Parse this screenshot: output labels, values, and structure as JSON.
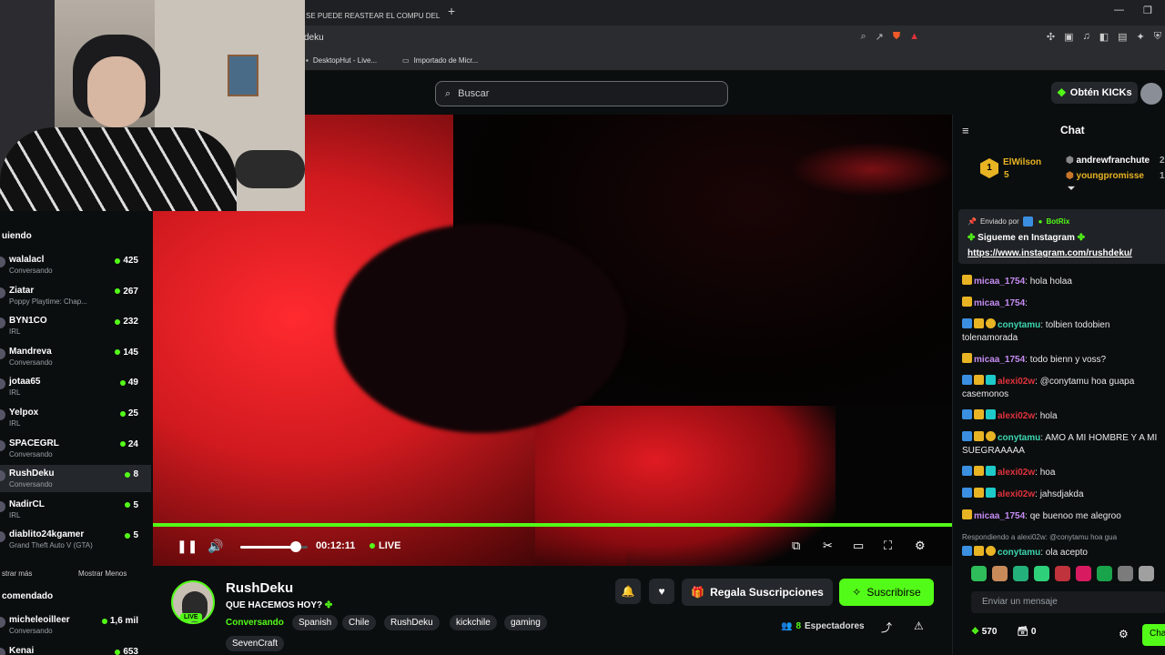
{
  "browser": {
    "tab_title": "SE PUEDE REASTEAR EL COMPU DEL",
    "new_tab": "+",
    "url": "deku",
    "bookmarks": [
      {
        "label": "DesktopHut - Live..."
      },
      {
        "label": "Importado de Micr..."
      }
    ]
  },
  "header": {
    "search_placeholder": "Buscar",
    "kicks_label": "Obtén KICKs"
  },
  "sidebar": {
    "following_title": "uiendo",
    "channels": [
      {
        "name": "walalacl",
        "category": "Conversando",
        "viewers": "425"
      },
      {
        "name": "Ziatar",
        "category": "Poppy Playtime: Chap...",
        "viewers": "267"
      },
      {
        "name": "BYN1CO",
        "category": "IRL",
        "viewers": "232"
      },
      {
        "name": "Mandreva",
        "category": "Conversando",
        "viewers": "145"
      },
      {
        "name": "jotaa65",
        "category": "IRL",
        "viewers": "49"
      },
      {
        "name": "Yelpox",
        "category": "IRL",
        "viewers": "25"
      },
      {
        "name": "SPACEGRL",
        "category": "Conversando",
        "viewers": "24"
      },
      {
        "name": "RushDeku",
        "category": "Conversando",
        "viewers": "8"
      },
      {
        "name": "NadirCL",
        "category": "IRL",
        "viewers": "5"
      },
      {
        "name": "diablito24kgamer",
        "category": "Grand Theft Auto V (GTA)",
        "viewers": "5"
      }
    ],
    "show_more": "strar más",
    "show_less": "Mostrar Menos",
    "recommended_title": "comendado",
    "recommended": [
      {
        "name": "micheleoilleer",
        "category": "Conversando",
        "viewers": "1,6 mil"
      },
      {
        "name": "Kenai",
        "category": "",
        "viewers": "653"
      }
    ]
  },
  "player": {
    "time": "00:12:11",
    "live_label": "LIVE",
    "volume": 0.82,
    "progress": 1.0
  },
  "stream": {
    "channel": "RushDeku",
    "live_badge": "LIVE",
    "title": "QUE HACEMOS HOY?",
    "category": "Conversando",
    "tags": [
      "Spanish",
      "Chile",
      "RushDeku",
      "kickchile",
      "gaming",
      "SevenCraft"
    ],
    "gift_label": "Regala Suscripciones",
    "subscribe_label": "Suscribirse",
    "viewers_count": "8",
    "viewers_label": "Espectadores"
  },
  "chat": {
    "title": "Chat",
    "leaderboard": [
      {
        "rank": "1",
        "name": "ElWilson",
        "count": "5"
      },
      {
        "name": "andrewfranchute",
        "count": "2"
      },
      {
        "name": "youngpromisse",
        "count": "1"
      }
    ],
    "pinned": {
      "sent_by": "Enviado por",
      "sender": "BotRix",
      "text": "Sigueme en Instagram",
      "link": "https://www.instagram.com/rushdeku/"
    },
    "messages": [
      {
        "user": "micaa_1754",
        "text": ": hola holaa",
        "color": "#c58cf2",
        "badges": [
          "crown"
        ]
      },
      {
        "user": "micaa_1754",
        "text": ":",
        "color": "#c58cf2",
        "badges": [
          "crown"
        ]
      },
      {
        "user": "conytamu",
        "text": ": tolbien todobien tolenamorada",
        "color": "#3dd6b0",
        "badges": [
          "vip",
          "crown",
          "one"
        ]
      },
      {
        "user": "micaa_1754",
        "text": ": todo bienn y voss?",
        "color": "#c58cf2",
        "badges": [
          "crown"
        ]
      },
      {
        "user": "alexi02w",
        "text": ": @conytamu hoa guapa casemonos",
        "color": "#e0323c",
        "badges": [
          "vip",
          "crown",
          "sub"
        ]
      },
      {
        "user": "alexi02w",
        "text": ": hola",
        "color": "#e0323c",
        "badges": [
          "vip",
          "crown",
          "sub"
        ]
      },
      {
        "user": "conytamu",
        "text": ": AMO A MI HOMBRE Y A MI SUEGRAAAAA",
        "color": "#3dd6b0",
        "badges": [
          "vip",
          "crown",
          "one"
        ]
      },
      {
        "user": "alexi02w",
        "text": ": hoa",
        "color": "#e0323c",
        "badges": [
          "vip",
          "crown",
          "sub"
        ]
      },
      {
        "user": "alexi02w",
        "text": ": jahsdjakda",
        "color": "#e0323c",
        "badges": [
          "vip",
          "crown",
          "sub"
        ]
      },
      {
        "user": "micaa_1754",
        "text": ": qe buenoo me alegroo",
        "color": "#c58cf2",
        "badges": [
          "crown"
        ]
      },
      {
        "reply": "Respondiendo a alexi02w: @conytamu hoa gua",
        "user": "conytamu",
        "text": ": ola acepto",
        "color": "#3dd6b0",
        "badges": [
          "vip",
          "crown",
          "one"
        ]
      }
    ],
    "input_placeholder": "Enviar un mensaje",
    "points": "570",
    "gifts": "0",
    "send_label": "Cha"
  }
}
